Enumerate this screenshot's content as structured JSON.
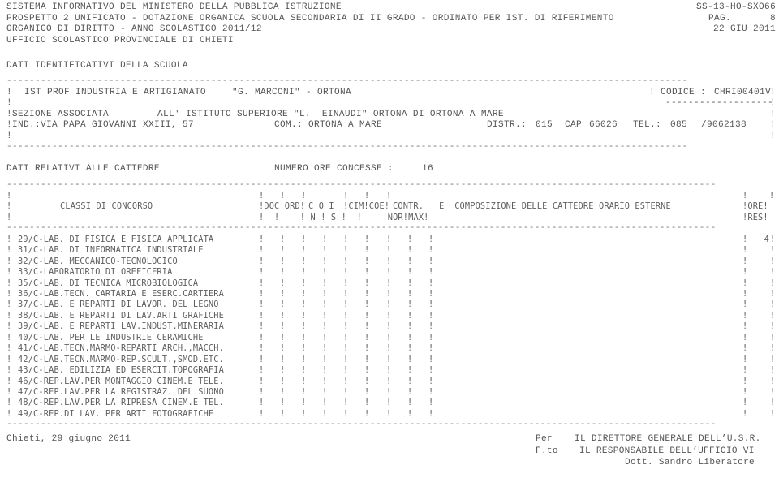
{
  "document": {
    "header": {
      "line1_left": "SISTEMA INFORMATIVO DEL MINISTERO DELLA PUBBLICA ISTRUZIONE",
      "line1_right": "SS-13-HO-SXO66",
      "line2_left": "PROSPETTO 2 UNIFICATO - DOTAZIONE ORGANICA SCUOLA SECONDARIA DI II GRADO - ORDINATO PER IST. DI RIFERIMENTO",
      "line2_right_label": "PAG.",
      "line2_right_value": "8",
      "line3_left": "ORGANICO DI DIRITTO - ANNO SCOLASTICO 2011/12",
      "line3_right": "22 GIU 2011",
      "line4_left": "UFFICIO SCOLASTICO PROVINCIALE DI CHIETI"
    },
    "school_section": {
      "section_title": "DATI IDENTIFICATIVI DELLA SCUOLA",
      "rule": "------------------------------------------------------------------------------------------------------------------------",
      "bar": "!",
      "school_name": "IST PROF INDUSTRIA E ARTIGIANATO",
      "school_denomination": "\"G. MARCONI\" - ORTONA",
      "codice_label": "CODICE :",
      "codice_value": "CHRI00401V",
      "codice_underline": "--------------------",
      "associated_label": "!SEZIONE ASSOCIATA",
      "associated_value": "ALL' ISTITUTO SUPERIORE \"L.  EINAUDI\" ORTONA DI ORTONA A MARE",
      "address_label": "!IND.:",
      "address_value": "VIA PAPA GIOVANNI XXIII, 57",
      "comune_label": "COM.:",
      "comune_value": "ORTONA A MARE",
      "distretto_label": "DISTR.:",
      "distretto_value": "015",
      "cap_label": "CAP",
      "cap_value": "66026",
      "tel_label": "TEL.:",
      "tel_prefix": "085",
      "tel_value": "/9062138"
    },
    "cattedre_section": {
      "title": "DATI RELATIVI ALLE CATTEDRE",
      "hours_label": "NUMERO ORE CONCESSE :",
      "hours_value": "16",
      "rule": "-----------------------------------------------------------------------------------------------------------------------------",
      "header_row1_cols": [
        "!",
        "!",
        "!",
        "!",
        "!",
        "!"
      ],
      "header_col_title": "CLASSI DI CONCORSO",
      "header_doc": "!DOC!ORD!",
      "header_coi": "C O I",
      "header_cim": "!CIM!COE!",
      "header_contr": "CONTR.   E  COMPOSIZIONE DELLE CATTEDRE ORARIO ESTERNE",
      "header_ore": "!ORE!",
      "header_n": "!  !    ! N ! S !  !    !NOR!MAX!",
      "header_res": "!RES!",
      "rows": [
        {
          "code": "29/C-LAB. DI FISICA E FISICA APPLICATA",
          "closing": "!",
          "ore_res": "4"
        },
        {
          "code": "31/C-LAB. DI INFORMATICA INDUSTRIALE",
          "closing": "!",
          "ore_res": ""
        },
        {
          "code": "32/C-LAB. MECCANICO-TECNOLOGICO",
          "closing": "!",
          "ore_res": ""
        },
        {
          "code": "33/C-LABORATORIO DI OREFICERIA",
          "closing": "!",
          "ore_res": ""
        },
        {
          "code": "35/C-LAB. DI TECNICA MICROBIOLOGICA",
          "closing": "!",
          "ore_res": ""
        },
        {
          "code": "36/C-LAB.TECN. CARTARIA E ESERC.CARTIERA",
          "closing": "!",
          "ore_res": ""
        },
        {
          "code": "37/C-LAB. E REPARTI DI LAVOR. DEL LEGNO",
          "closing": "!",
          "ore_res": ""
        },
        {
          "code": "38/C-LAB. E REPARTI DI LAV.ARTI GRAFICHE",
          "closing": "!",
          "ore_res": ""
        },
        {
          "code": "39/C-LAB. E REPARTI LAV.INDUST.MINERARIA",
          "closing": "!",
          "ore_res": ""
        },
        {
          "code": "40/C-LAB. PER LE INDUSTRIE CERAMICHE",
          "closing": "!",
          "ore_res": ""
        },
        {
          "code": "41/C-LAB.TECN.MARMO-REPARTI ARCH.,MACCH.",
          "closing": "!",
          "ore_res": ""
        },
        {
          "code": "42/C-LAB.TECN.MARMO-REP.SCULT.,SMOD.ETC.",
          "closing": "!",
          "ore_res": ""
        },
        {
          "code": "43/C-LAB. EDILIZIA ED ESERCIT.TOPOGRAFIA",
          "closing": "!",
          "ore_res": ""
        },
        {
          "code": "46/C-REP.LAV.PER MONTAGGIO CINEM.E TELE.",
          "closing": "!",
          "ore_res": ""
        },
        {
          "code": "47/C-REP.LAV.PER LA REGISTRAZ. DEL SUONO",
          "closing": "!",
          "ore_res": ""
        },
        {
          "code": "48/C-REP.LAV.PER LA RIPRESA CINEM.E TEL.",
          "closing": "!",
          "ore_res": ""
        },
        {
          "code": "49/C-REP.DI LAV. PER ARTI FOTOGRAFICHE",
          "closing": "!",
          "ore_res": ""
        }
      ],
      "row_separators": "!    !    !    !    !    !    !    !    !",
      "row_bar": "!"
    },
    "footer": {
      "place_date": "Chieti, 29 giugno 2011",
      "per_label": "Per",
      "director_title": "IL DIRETTORE GENERALE DELL’U.S.R.",
      "fto_label": "F.to",
      "responsible_title": "IL RESPONSABILE DELL’UFFICIO VI",
      "signer_name": "Dott. Sandro Liberatore"
    }
  }
}
